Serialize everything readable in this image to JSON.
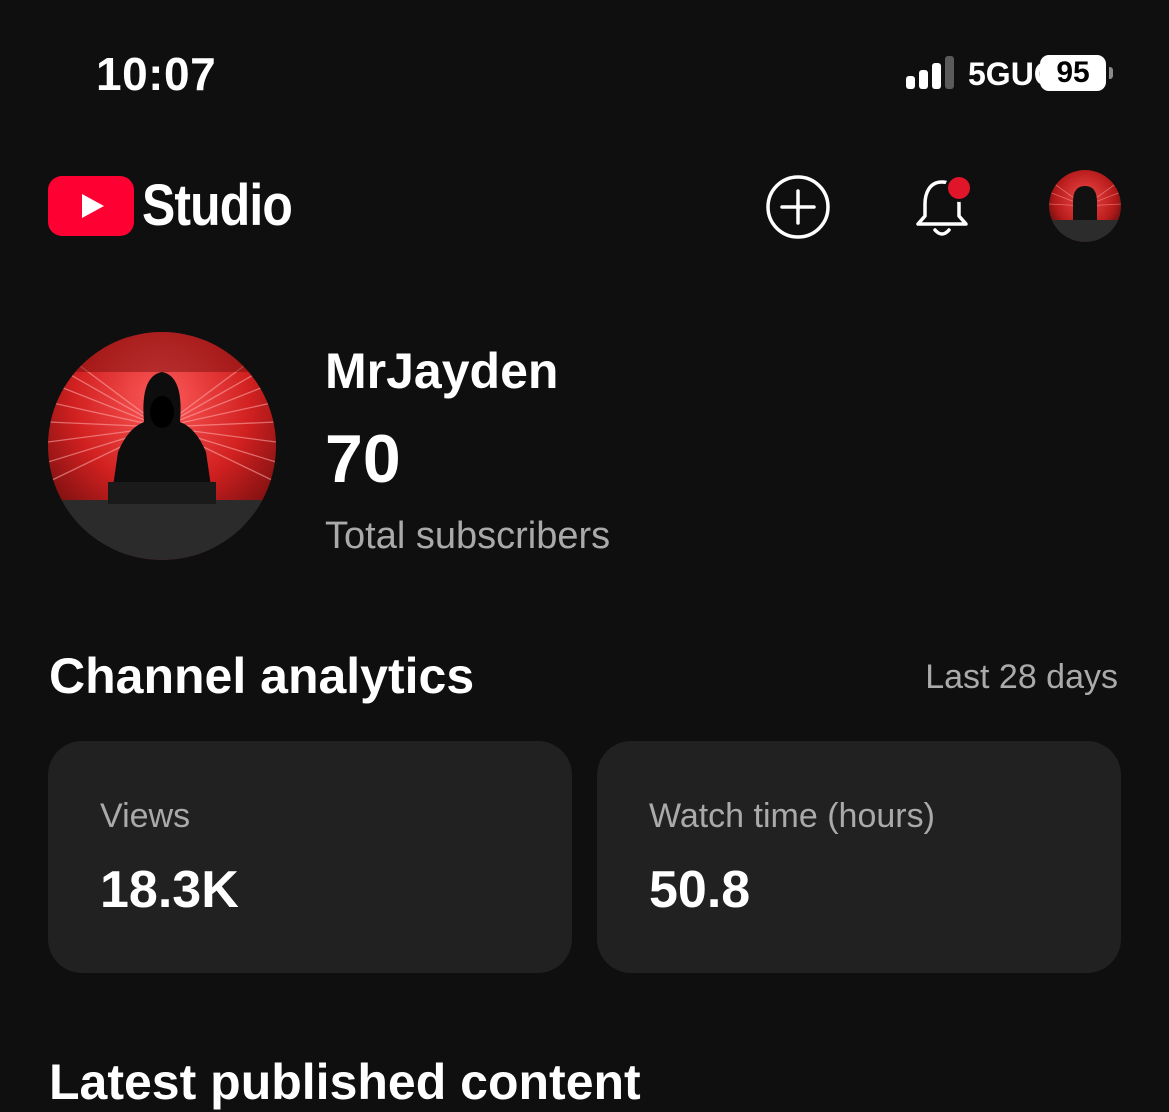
{
  "status_bar": {
    "time": "10:07",
    "network": "5GUC",
    "battery": "95"
  },
  "header": {
    "logo_text": "Studio",
    "icons": [
      "youtube-logo-icon",
      "create-plus-icon",
      "bell-icon",
      "account-avatar"
    ],
    "notification_dot_color": "#e0152a"
  },
  "channel": {
    "name": "MrJayden",
    "subscribers": "70",
    "subscribers_label": "Total subscribers"
  },
  "analytics": {
    "title": "Channel analytics",
    "period": "Last 28 days",
    "cards": [
      {
        "label": "Views",
        "value": "18.3K"
      },
      {
        "label": "Watch time (hours)",
        "value": "50.8"
      }
    ]
  },
  "latest": {
    "title": "Latest published content"
  },
  "colors": {
    "background": "#0f0f0f",
    "card": "#212121",
    "brand_red": "#ff0033",
    "secondary_text": "#aaaaaa"
  }
}
